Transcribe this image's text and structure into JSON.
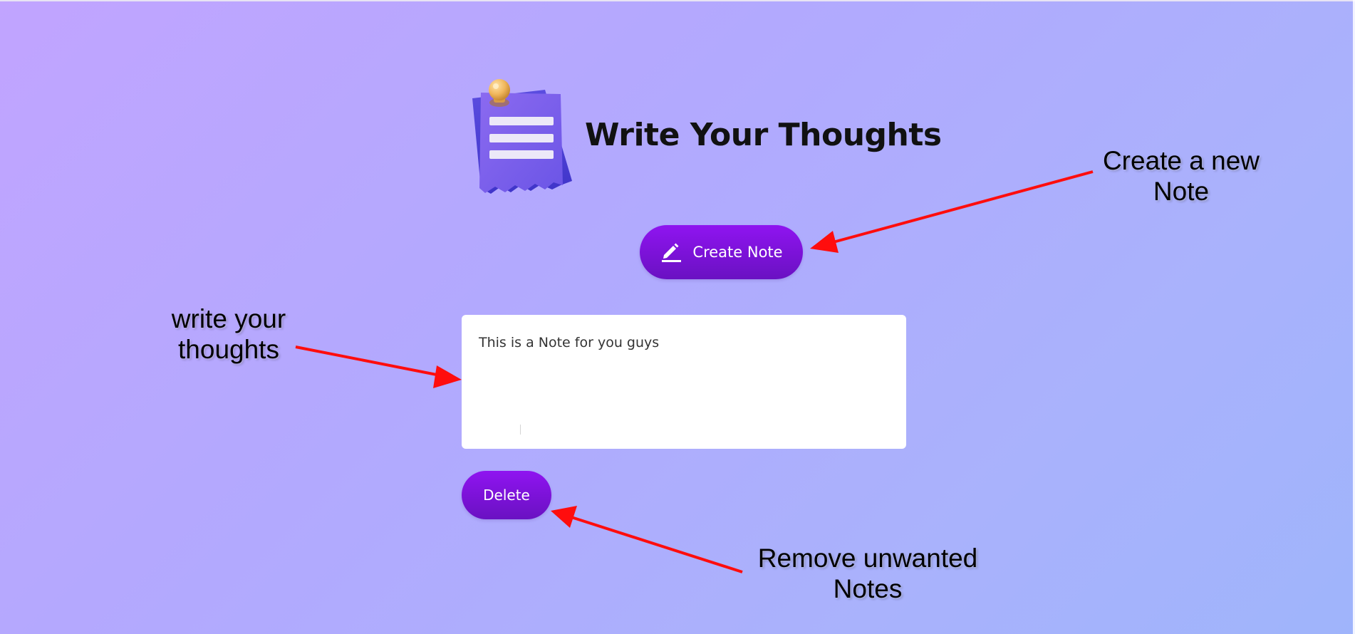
{
  "app": {
    "title": "Write Your Thoughts",
    "logo_icon": "note-pin-icon"
  },
  "toolbar": {
    "create_label": "Create Note",
    "create_icon": "pencil-icon"
  },
  "notes": [
    {
      "text": "This is a Note for you guys",
      "delete_label": "Delete"
    }
  ],
  "annotations": {
    "create": {
      "line1": "Create a new",
      "line2": "Note"
    },
    "write": {
      "line1": "write your",
      "line2": "thoughts"
    },
    "remove": {
      "line1": "Remove unwanted",
      "line2": "Notes"
    }
  },
  "colors": {
    "button_top": "#8f14f0",
    "button_bottom": "#6a11c2",
    "arrow": "#ff0d0d",
    "background_start": "#c1a4ff",
    "background_end": "#9fb4fb"
  }
}
